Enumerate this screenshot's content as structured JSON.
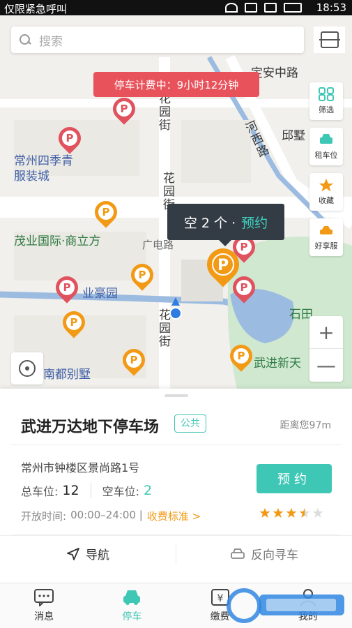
{
  "status_bar": {
    "carrier": "仅限紧急呼叫",
    "time": "18:53"
  },
  "search": {
    "placeholder": "搜索"
  },
  "map": {
    "fee_banner": "停车计费中：9小时12分钟",
    "labels": {
      "dinganzhong": "定安中路",
      "hexi": "河西路",
      "qiushu": "邱墅",
      "sijiqing": "常州四季青服装城",
      "huayuan_top": "花园街",
      "huayuan_mid": "花园街",
      "huayuan_bottom": "花园街",
      "guangdian": "广电路",
      "maoye": "茂业国际·商立方",
      "yehaoyuan": "业豪园",
      "shitian": "石田",
      "nandu": "南都别墅",
      "wujin": "武进新天"
    },
    "popup": {
      "text": "空 2 个 · ",
      "action": "预约"
    },
    "tools": [
      {
        "label": "筛选",
        "icon": "filter-icon"
      },
      {
        "label": "租车位",
        "icon": "car-rent-icon"
      },
      {
        "label": "收藏",
        "icon": "star-icon"
      },
      {
        "label": "好享服",
        "icon": "service-car-icon"
      }
    ],
    "zoom": {
      "in": "+",
      "out": "—"
    }
  },
  "parking_lot": {
    "name": "武进万达地下停车场",
    "type_tag": "公共",
    "distance": "距离您97m",
    "address": "常州市钟楼区景尚路1号",
    "total_label": "总车位:",
    "total": "12",
    "free_label": "空车位:",
    "free": "2",
    "hours_label": "开放时间:",
    "hours": "00:00–24:00 |",
    "fee_link": "收费标准 >",
    "reserve": "预约",
    "rating": 3.5,
    "rating_max": 5
  },
  "actions": {
    "navigate": "导航",
    "find_car": "反向寻车"
  },
  "tabs": [
    {
      "label": "消息",
      "icon": "message-icon",
      "active": false
    },
    {
      "label": "停车",
      "icon": "car-icon",
      "active": true
    },
    {
      "label": "缴费",
      "icon": "payment-icon",
      "active": false
    },
    {
      "label": "我的",
      "icon": "profile-icon",
      "active": false
    }
  ],
  "colors": {
    "accent": "#3fc7b5",
    "fee_banner": "#e8525b",
    "pin_red": "#e0525e",
    "pin_orange": "#f29a15",
    "link": "#f29a15"
  }
}
